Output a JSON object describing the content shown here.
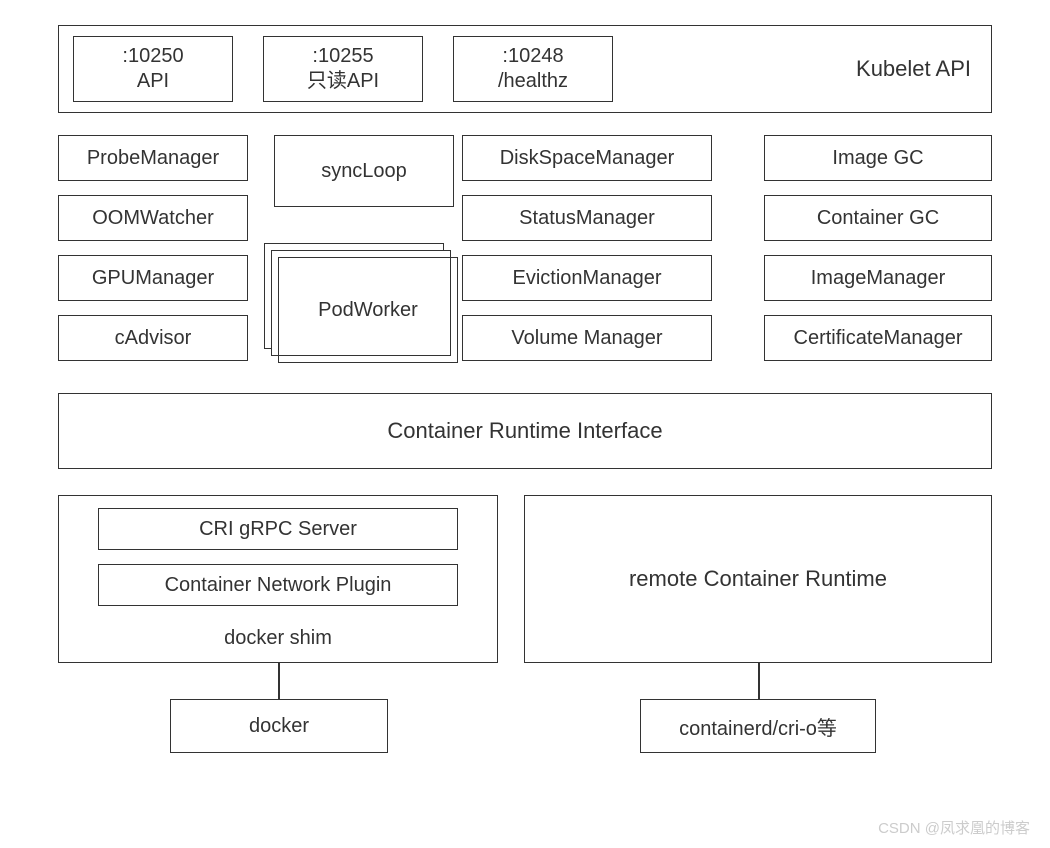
{
  "header": {
    "title": "Kubelet API",
    "ports": [
      {
        "port": ":10250",
        "label": "API"
      },
      {
        "port": ":10255",
        "label": "只读API"
      },
      {
        "port": ":10248",
        "label": "/healthz"
      }
    ]
  },
  "components": {
    "col1": [
      "ProbeManager",
      "OOMWatcher",
      "GPUManager",
      "cAdvisor"
    ],
    "col2": {
      "top": "syncLoop",
      "stack": "PodWorker"
    },
    "col3": [
      "DiskSpaceManager",
      "StatusManager",
      "EvictionManager",
      "Volume Manager"
    ],
    "col4": [
      "Image GC",
      "Container GC",
      "ImageManager",
      "CertificateManager"
    ]
  },
  "cri": "Container Runtime Interface",
  "shim": {
    "inner1": "CRI gRPC Server",
    "inner2": "Container Network Plugin",
    "label": "docker shim"
  },
  "remote": "remote Container Runtime",
  "leaves": {
    "docker": "docker",
    "containerd": "containerd/cri-o等"
  },
  "watermark": "CSDN @凤求凰的博客"
}
